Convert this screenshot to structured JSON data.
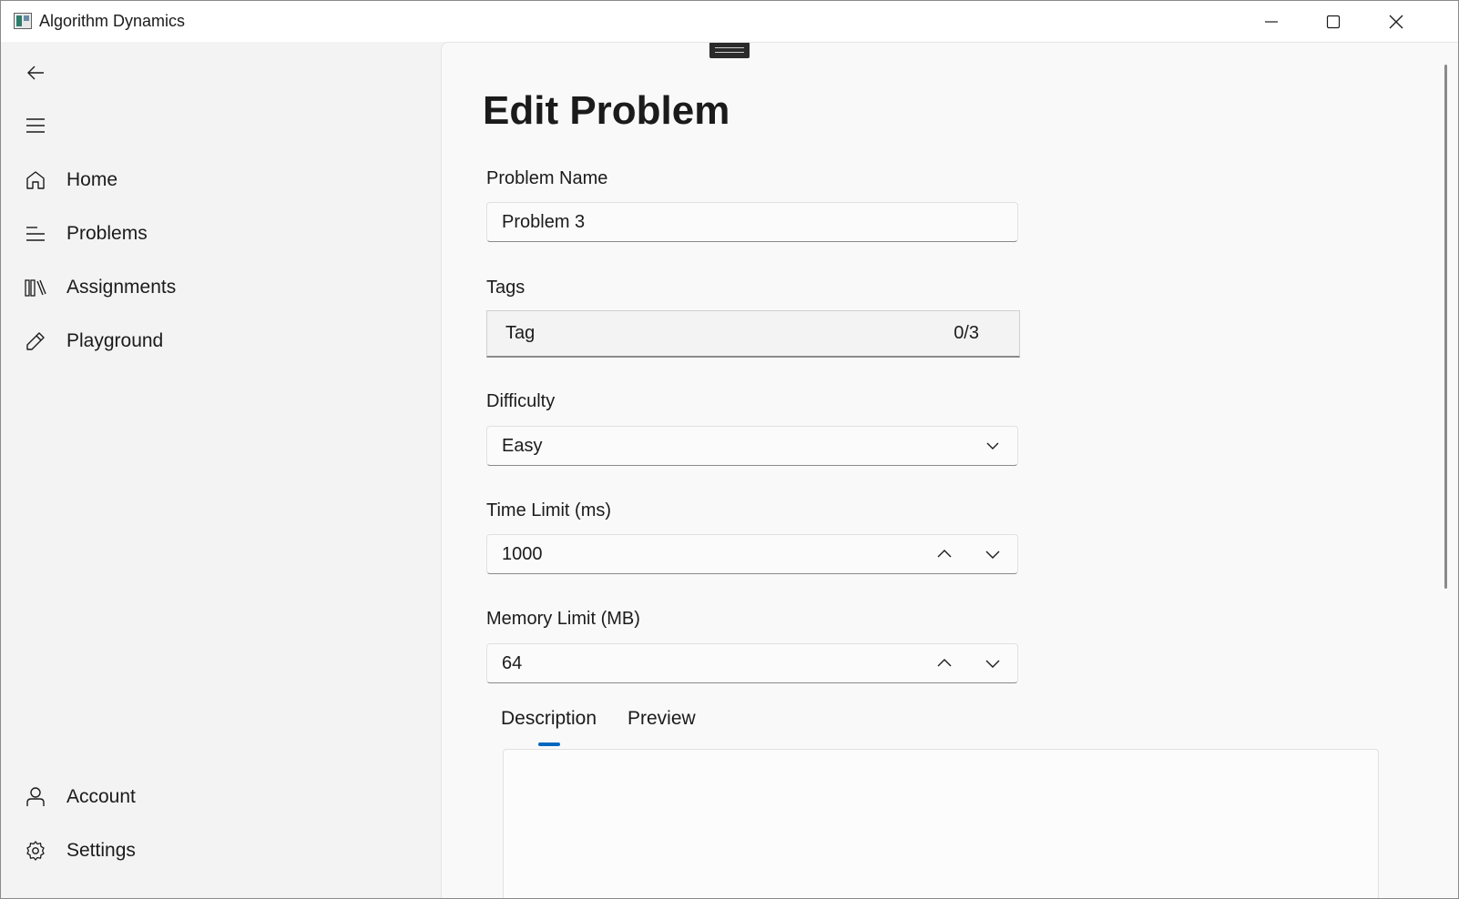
{
  "window": {
    "title": "Algorithm Dynamics",
    "app_icon": "app-icon"
  },
  "sidebar": {
    "back_icon": "back-arrow-icon",
    "menu_icon": "hamburger-menu-icon",
    "items": [
      {
        "label": "Home",
        "icon": "home-icon"
      },
      {
        "label": "Problems",
        "icon": "list-icon"
      },
      {
        "label": "Assignments",
        "icon": "library-icon"
      },
      {
        "label": "Playground",
        "icon": "pencil-icon"
      }
    ],
    "footer_items": [
      {
        "label": "Account",
        "icon": "person-icon"
      },
      {
        "label": "Settings",
        "icon": "gear-icon"
      }
    ]
  },
  "page": {
    "title": "Edit Problem"
  },
  "form": {
    "problem_name": {
      "label": "Problem Name",
      "value": "Problem 3"
    },
    "tags": {
      "label": "Tags",
      "placeholder": "Tag",
      "count": "0/3"
    },
    "difficulty": {
      "label": "Difficulty",
      "value": "Easy"
    },
    "time_limit": {
      "label": "Time Limit (ms)",
      "value": "1000"
    },
    "memory_limit": {
      "label": "Memory Limit (MB)",
      "value": "64"
    }
  },
  "tabs": [
    {
      "label": "Description",
      "selected": true
    },
    {
      "label": "Preview",
      "selected": false
    }
  ],
  "colors": {
    "accent": "#0067c0",
    "background": "#f3f3f3"
  }
}
